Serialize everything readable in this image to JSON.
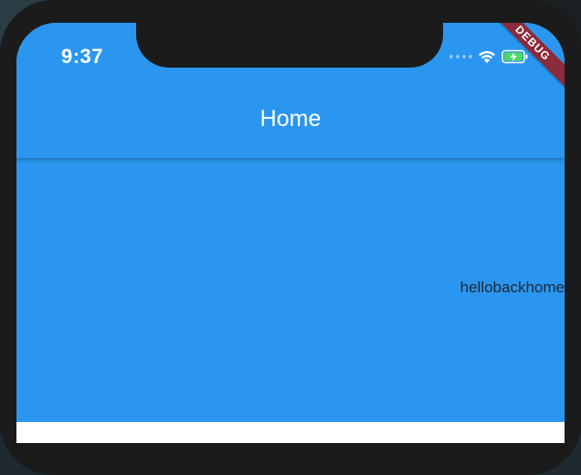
{
  "status_bar": {
    "time": "9:37",
    "icons": [
      "signal-dots-icon",
      "wifi-icon",
      "battery-charging-icon"
    ]
  },
  "app_bar": {
    "title": "Home"
  },
  "body": {
    "text": "hellobackhome"
  },
  "debug_banner": {
    "label": "DEBUG"
  },
  "colors": {
    "primary": "#2b96ef",
    "debug_banner": "#8c2b3a",
    "body_text": "#1d2833",
    "battery_fill": "#4cd964"
  }
}
